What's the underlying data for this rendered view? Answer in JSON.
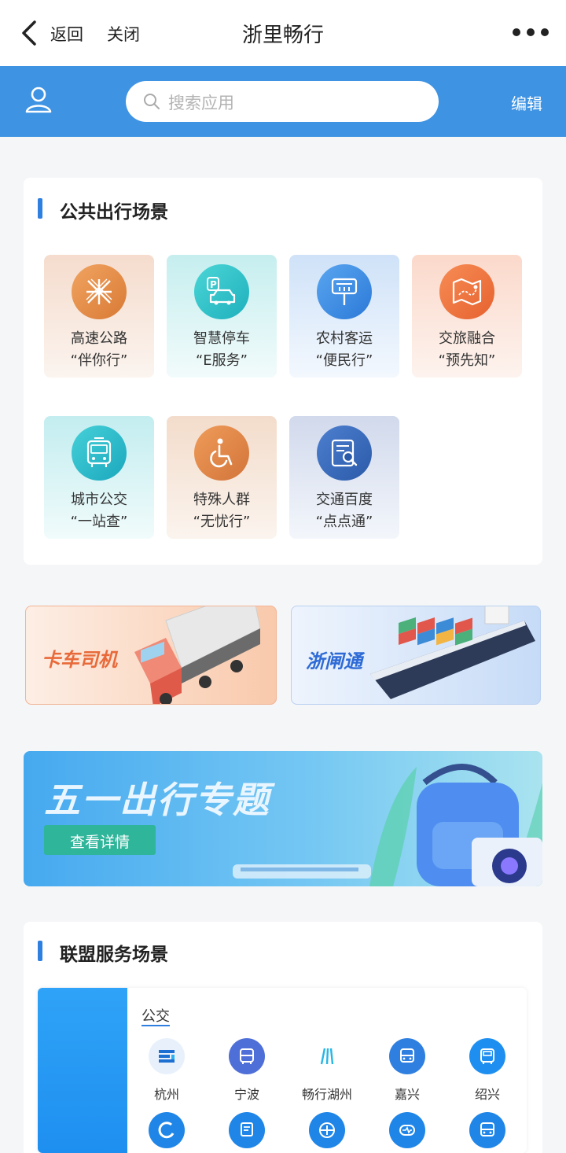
{
  "nav": {
    "back_label": "返回",
    "close_label": "关闭",
    "title": "浙里畅行"
  },
  "header": {
    "search_placeholder": "搜索应用",
    "edit_label": "编辑"
  },
  "public_section": {
    "title": "公共出行场景",
    "tiles": [
      {
        "line1": "高速公路",
        "line2": "“伴你行”",
        "icon": "highway-icon",
        "color": "#e8914a"
      },
      {
        "line1": "智慧停车",
        "line2": "“E服务”",
        "icon": "parking-car-icon",
        "color": "#2fc3c9"
      },
      {
        "line1": "农村客运",
        "line2": "“便民行”",
        "icon": "bus-stop-sign-icon",
        "color": "#3b8ce6"
      },
      {
        "line1": "交旅融合",
        "line2": "“预先知”",
        "icon": "map-icon",
        "color": "#f07b45"
      },
      {
        "line1": "城市公交",
        "line2": "“一站查”",
        "icon": "city-bus-icon",
        "color": "#2bbcc8"
      },
      {
        "line1": "特殊人群",
        "line2": "“无忧行”",
        "icon": "wheelchair-icon",
        "color": "#e0874a"
      },
      {
        "line1": "交通百度",
        "line2": "“点点通”",
        "icon": "search-document-icon",
        "color": "#3a6fbd"
      }
    ]
  },
  "promo": {
    "truck_label": "卡车司机",
    "ship_label": "浙闸通",
    "may_day_title": "五一出行专题",
    "may_day_button": "查看详情"
  },
  "alliance_section": {
    "title": "联盟服务场景",
    "active_tab": "公交",
    "cities": [
      "杭州",
      "宁波",
      "畅行湖州",
      "嘉兴",
      "绍兴"
    ]
  }
}
